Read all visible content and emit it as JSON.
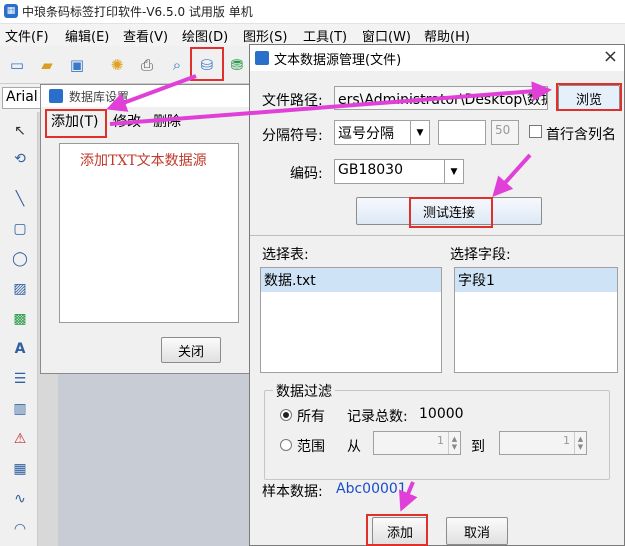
{
  "app": {
    "title": "中琅条码标签打印软件-V6.5.0 试用版 单机"
  },
  "menu": [
    "文件(F)",
    "编辑(E)",
    "查看(V)",
    "绘图(D)",
    "图形(S)",
    "工具(T)",
    "窗口(W)",
    "帮助(H)"
  ],
  "font": {
    "name": "Arial"
  },
  "db_dialog": {
    "title": "数据库设置",
    "menu": [
      "添加(T)",
      "修改",
      "删除"
    ],
    "hint": "添加TXT文本数据源",
    "close_label": "关闭"
  },
  "txt_dialog": {
    "title": "文本数据源管理(文件)",
    "close_icon": "×",
    "file_path_label": "文件路径:",
    "file_path_value": "ers\\Administrator\\Desktop\\数据.txt",
    "browse_label": "浏览",
    "separator_label": "分隔符号:",
    "separator_value": "逗号分隔",
    "separator_num": "50",
    "header_checkbox_label": "首行含列名",
    "encoding_label": "编码:",
    "encoding_value": "GB18030",
    "test_label": "测试连接",
    "table_label": "选择表:",
    "tables": [
      "数据.txt"
    ],
    "field_label": "选择字段:",
    "fields": [
      "字段1"
    ],
    "filter": {
      "legend": "数据过滤",
      "all_label": "所有",
      "total_label": "记录总数:",
      "total_value": "10000",
      "range_label": "范围",
      "from_label": "从",
      "from_value": "1",
      "to_label": "到",
      "to_value": "1"
    },
    "sample_label": "样本数据:",
    "sample_value": "Abc00001",
    "add_label": "添加",
    "cancel_label": "取消"
  },
  "colors": {
    "highlight": "#e0302c",
    "arrow": "#e040d8",
    "hint_text": "#c0392b",
    "sample_text": "#1a4ec8"
  },
  "icons": [
    "app-logo-icon",
    "new-icon",
    "open-icon",
    "save-icon",
    "settings-gear-icon",
    "print-icon",
    "print-preview-icon",
    "database-icon",
    "database-setting-icon",
    "chevron-down-icon",
    "close-icon"
  ]
}
